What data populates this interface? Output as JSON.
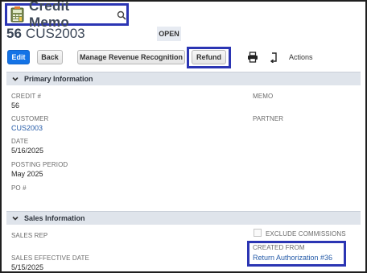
{
  "header": {
    "title": "Credit Memo",
    "record_number": "56",
    "customer_code": "CUS2003",
    "status": "OPEN"
  },
  "toolbar": {
    "edit_label": "Edit",
    "back_label": "Back",
    "manage_revenue_label": "Manage Revenue Recognition",
    "refund_label": "Refund",
    "actions_label": "Actions"
  },
  "primary": {
    "section_title": "Primary Information",
    "credit_label": "CREDIT #",
    "credit_value": "56",
    "customer_label": "CUSTOMER",
    "customer_value": "CUS2003",
    "date_label": "DATE",
    "date_value": "5/16/2025",
    "posting_label": "POSTING PERIOD",
    "posting_value": "May 2025",
    "po_label": "PO #",
    "memo_label": "MEMO",
    "partner_label": "PARTNER"
  },
  "sales": {
    "section_title": "Sales Information",
    "rep_label": "SALES REP",
    "exclude_label": "EXCLUDE COMMISSIONS",
    "created_from_label": "CREATED FROM",
    "created_from_value": "Return Authorization #36",
    "effective_label": "SALES EFFECTIVE DATE",
    "effective_value": "5/15/2025"
  },
  "icons": {
    "title": "calculator-icon",
    "search": "search-icon",
    "print": "printer-icon",
    "refresh": "refresh-icon",
    "chevron": "chevron-down-icon"
  },
  "colors": {
    "primary_button": "#1473e6",
    "link": "#255ba8",
    "highlight_border": "#2b35b3",
    "section_bg": "#dfe4eb"
  }
}
